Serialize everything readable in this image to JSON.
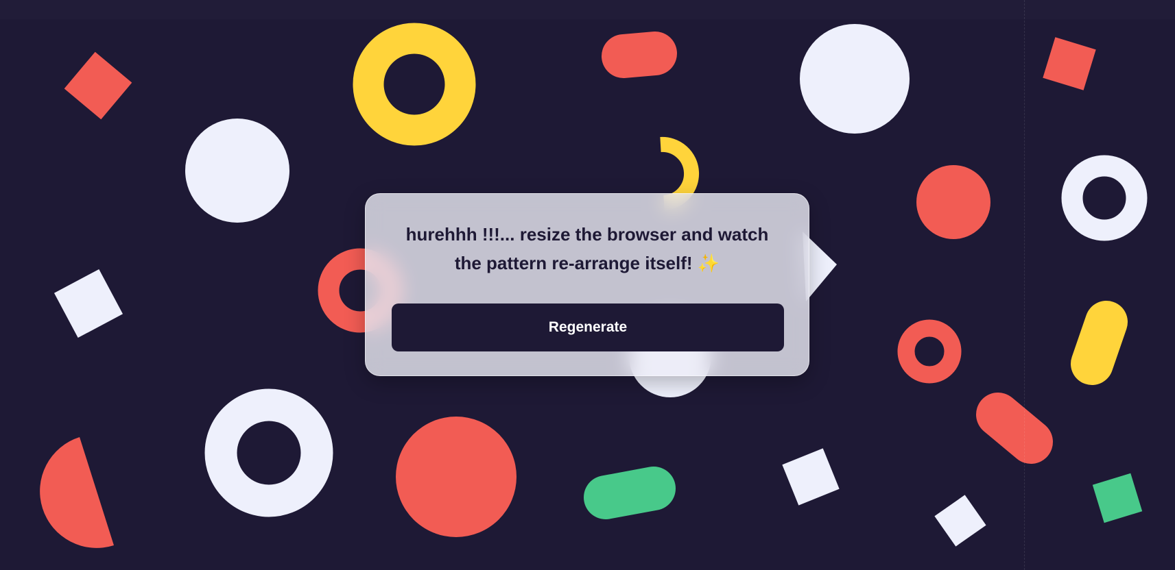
{
  "card": {
    "message": "hurehhh !!!... resize the browser and watch the pattern re-arrange itself!",
    "emoji": "✨",
    "button_label": "Regenerate"
  },
  "colors": {
    "background": "#1e1935",
    "coral": "#f25c54",
    "yellow": "#ffd43b",
    "white": "#eef0fc",
    "green": "#48c98a"
  },
  "pattern": {
    "shape_kinds": [
      "square",
      "circle",
      "ring",
      "pill",
      "half-circle",
      "arc"
    ]
  }
}
